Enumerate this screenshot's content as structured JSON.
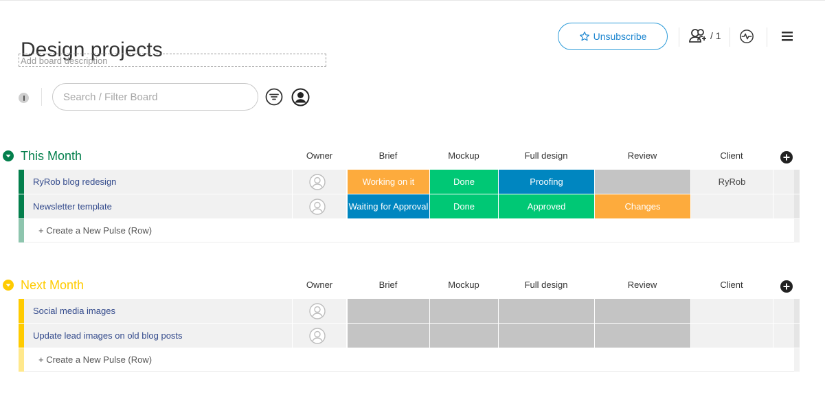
{
  "board": {
    "title": "Design projects",
    "description_placeholder": "Add board description"
  },
  "header": {
    "unsubscribe_label": "Unsubscribe",
    "members_count": "/ 1"
  },
  "toolbar": {
    "search_placeholder": "Search / Filter Board"
  },
  "columns": [
    "Owner",
    "Brief",
    "Mockup",
    "Full design",
    "Review",
    "Client"
  ],
  "groups": [
    {
      "title": "This Month",
      "color": "#037f4c",
      "rows": [
        {
          "name": "RyRob blog redesign",
          "brief": {
            "text": "Working on it",
            "color": "#fdab3d"
          },
          "mockup": {
            "text": "Done",
            "color": "#00c875"
          },
          "full_design": {
            "text": "Proofing",
            "color": "#0086c0"
          },
          "review": {
            "text": "",
            "color": "#c4c4c4"
          },
          "client": "RyRob"
        },
        {
          "name": "Newsletter template",
          "brief": {
            "text": "Waiting for Approval",
            "color": "#0086c0"
          },
          "mockup": {
            "text": "Done",
            "color": "#00c875"
          },
          "full_design": {
            "text": "Approved",
            "color": "#00c875"
          },
          "review": {
            "text": "Changes",
            "color": "#fdab3d"
          },
          "client": ""
        }
      ],
      "new_row_label": "+ Create a New Pulse (Row)"
    },
    {
      "title": "Next Month",
      "color": "#ffcb00",
      "rows": [
        {
          "name": "Social media images",
          "brief": {
            "text": "",
            "color": "#c4c4c4"
          },
          "mockup": {
            "text": "",
            "color": "#c4c4c4"
          },
          "full_design": {
            "text": "",
            "color": "#c4c4c4"
          },
          "review": {
            "text": "",
            "color": "#c4c4c4"
          },
          "client": ""
        },
        {
          "name": "Update lead images on old blog posts",
          "brief": {
            "text": "",
            "color": "#c4c4c4"
          },
          "mockup": {
            "text": "",
            "color": "#c4c4c4"
          },
          "full_design": {
            "text": "",
            "color": "#c4c4c4"
          },
          "review": {
            "text": "",
            "color": "#c4c4c4"
          },
          "client": ""
        }
      ],
      "new_row_label": "+ Create a New Pulse (Row)"
    }
  ]
}
